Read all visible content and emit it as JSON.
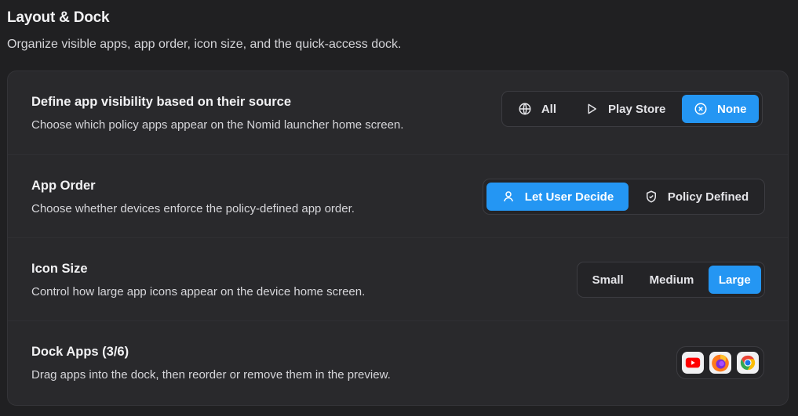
{
  "header": {
    "title": "Layout & Dock",
    "subtitle": "Organize visible apps, app order, icon size, and the quick-access dock."
  },
  "visibility": {
    "title": "Define app visibility based on their source",
    "description": "Choose which policy apps appear on the Nomid launcher home screen.",
    "options": [
      "All",
      "Play Store",
      "None"
    ],
    "selected": "None"
  },
  "order": {
    "title": "App Order",
    "description": "Choose whether devices enforce the policy-defined app order.",
    "options": [
      "Let User Decide",
      "Policy Defined"
    ],
    "selected": "Let User Decide"
  },
  "icon_size": {
    "title": "Icon Size",
    "description": "Control how large app icons appear on the device home screen.",
    "options": [
      "Small",
      "Medium",
      "Large"
    ],
    "selected": "Large"
  },
  "dock": {
    "title": "Dock Apps (3/6)",
    "description": "Drag apps into the dock, then reorder or remove them in the preview.",
    "apps": [
      "youtube-icon",
      "firefox-icon",
      "chrome-icon"
    ]
  },
  "colors": {
    "accent": "#2496f3",
    "background": "#202022",
    "card": "#29292c"
  }
}
